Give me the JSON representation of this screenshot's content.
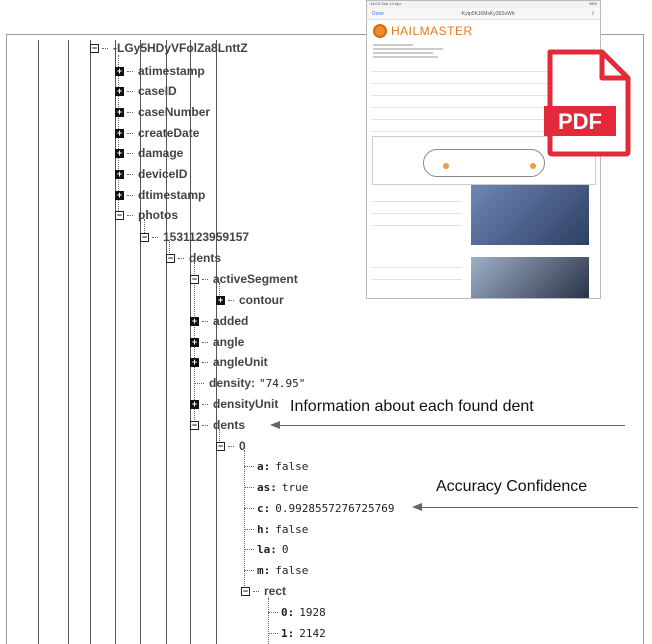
{
  "tree": {
    "root_key": "-LGy5HDyVFolZa8LnttZ",
    "children_collapsed": [
      "atimestamp",
      "caseID",
      "caseNumber",
      "createDate",
      "damage",
      "deviceID",
      "dtimestamp"
    ],
    "photos_key": "photos",
    "photo_id": "1531123959157",
    "dents_key": "dents",
    "active_segment_key": "activeSegment",
    "contour_key": "contour",
    "added_key": "added",
    "angle_key": "angle",
    "angle_unit_key": "angleUnit",
    "density_key": "density:",
    "density_value": "\"74.95\"",
    "density_unit_key": "densityUnit",
    "inner_dents_key": "dents",
    "index_key": "0",
    "fields": [
      {
        "key": "a:",
        "value": "false"
      },
      {
        "key": "as:",
        "value": "true"
      },
      {
        "key": "c:",
        "value": "0.9928557276725769"
      },
      {
        "key": "h:",
        "value": "false"
      },
      {
        "key": "la:",
        "value": "0"
      },
      {
        "key": "m:",
        "value": "false"
      }
    ],
    "rect_key": "rect",
    "rect_fields": [
      {
        "key": "0:",
        "value": "1928"
      },
      {
        "key": "1:",
        "value": "2142"
      }
    ]
  },
  "annotations": {
    "dent_info": "Information about each found dent",
    "accuracy": "Accuracy Confidence"
  },
  "preview": {
    "status_time": "14:03  Sun 14 Apr",
    "status_right": "98%",
    "done": "Done",
    "title": "-Kytp5KJ6MsKy36SxWb",
    "brand": "HAILMASTER",
    "pdf_label": "PDF"
  }
}
